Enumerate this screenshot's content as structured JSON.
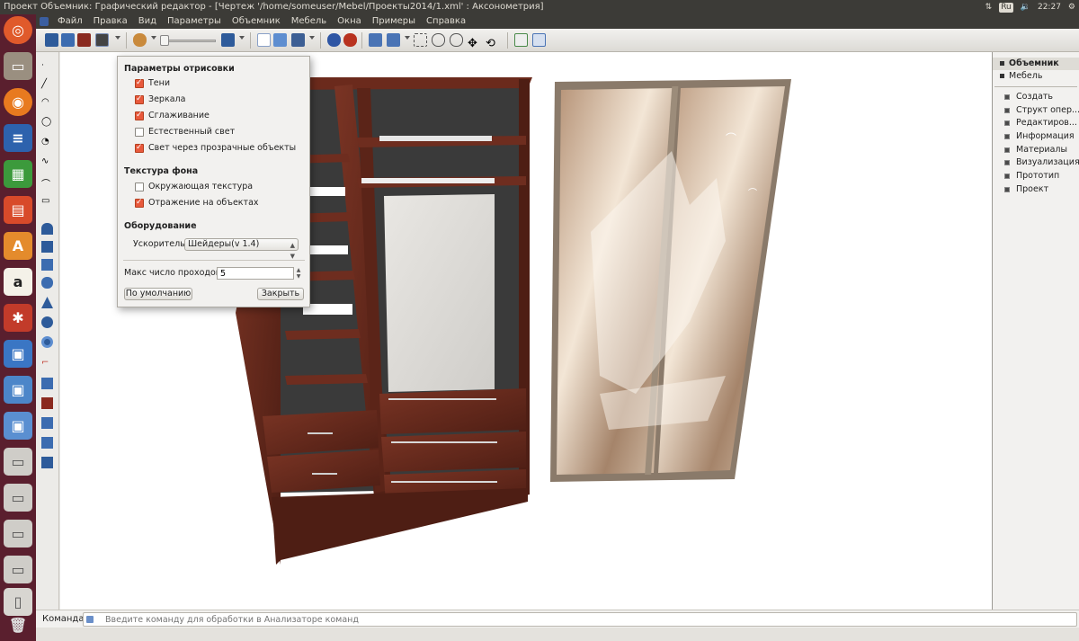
{
  "window": {
    "title": "Проект Объемник: Графический редактор - [Чертеж '/home/someuser/Mebel/Проекты2014/1.xml' : Аксонометрия]",
    "tray": {
      "keyboard": "Ru",
      "clock": "22:27"
    }
  },
  "menubar": [
    "Файл",
    "Правка",
    "Вид",
    "Параметры",
    "Объемник",
    "Мебель",
    "Окна",
    "Примеры",
    "Справка"
  ],
  "dialog": {
    "section_render": "Параметры отрисовки",
    "render_options": [
      {
        "label": "Тени",
        "checked": true
      },
      {
        "label": "Зеркала",
        "checked": true
      },
      {
        "label": "Сглаживание",
        "checked": true
      },
      {
        "label": "Естественный свет",
        "checked": false
      },
      {
        "label": "Свет через прозрачные объекты",
        "checked": true
      }
    ],
    "section_texture": "Текстура фона",
    "texture_options": [
      {
        "label": "Окружающая текстура",
        "checked": false
      },
      {
        "label": "Отражение на объектах",
        "checked": true
      }
    ],
    "section_hardware": "Оборудование",
    "accelerator_label": "Ускоритель:",
    "accelerator_value": "Шейдеры(v 1.4)",
    "passes_label": "Макс число проходов:",
    "passes_value": "5",
    "default_button": "По умолчанию",
    "close_button": "Закрыть"
  },
  "right_panel": {
    "tabs": [
      {
        "label": "Объемник",
        "active": true
      },
      {
        "label": "Мебель",
        "active": false
      }
    ],
    "items": [
      "Создать",
      "Структ опер...",
      "Редактиров...",
      "Информация",
      "Материалы",
      "Визуализация",
      "Прототип",
      "Проект"
    ]
  },
  "command_bar": {
    "label": "Команда:",
    "placeholder": "Введите команду для обработки в Анализаторе команд"
  },
  "colors": {
    "launcher": "#5a1f2e",
    "menubar": "#3c3b37",
    "checkbox_checked": "#e8593c",
    "wood": "#6b2a1c"
  },
  "icons": {
    "launcher": [
      "ubuntu-home-icon",
      "files-icon",
      "firefox-icon",
      "writer-icon",
      "calc-icon",
      "impress-icon",
      "software-center-icon",
      "amazon-icon",
      "settings-icon",
      "app-icon",
      "app-icon",
      "app-icon",
      "drive-icon",
      "drive-icon",
      "drive-icon",
      "drive-icon",
      "usb-icon",
      "trash-icon"
    ]
  }
}
